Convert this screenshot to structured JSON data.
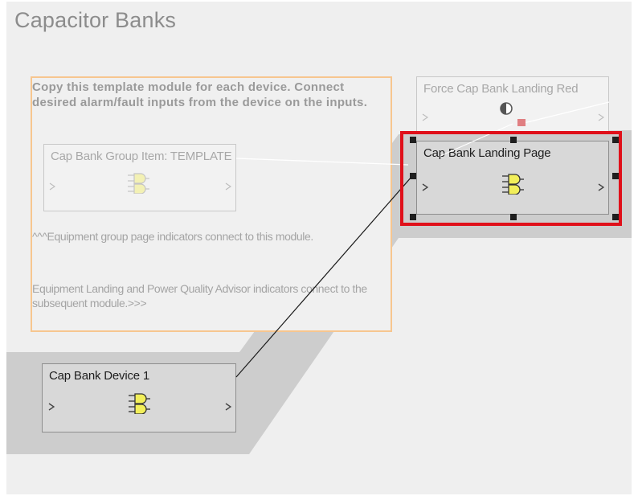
{
  "page": {
    "title": "Capacitor Banks"
  },
  "template_section": {
    "instructions": "Copy this template module for each device. Connect desired alarm/fault inputs from the device on the inputs.",
    "note_connect": "^^^Equipment group page indicators connect to this module.",
    "note_subsequent": "Equipment Landing and Power Quality Advisor indicators connect to the subsequent module.>>>"
  },
  "modules": {
    "group_template": {
      "title": "Cap Bank Group Item: TEMPLATE",
      "icon": "plug-icon"
    },
    "force_red": {
      "title": "Force Cap Bank Landing Red",
      "icon": "halfcircle-icon"
    },
    "landing_page": {
      "title": "Cap Bank Landing Page",
      "icon": "plug-icon",
      "selected": true
    },
    "device_1": {
      "title": "Cap Bank Device 1",
      "icon": "plug-icon"
    }
  },
  "colors": {
    "template_border": "#f7c68f",
    "selection": "#e0101a",
    "plug_yellow": "#f2ef5a"
  }
}
